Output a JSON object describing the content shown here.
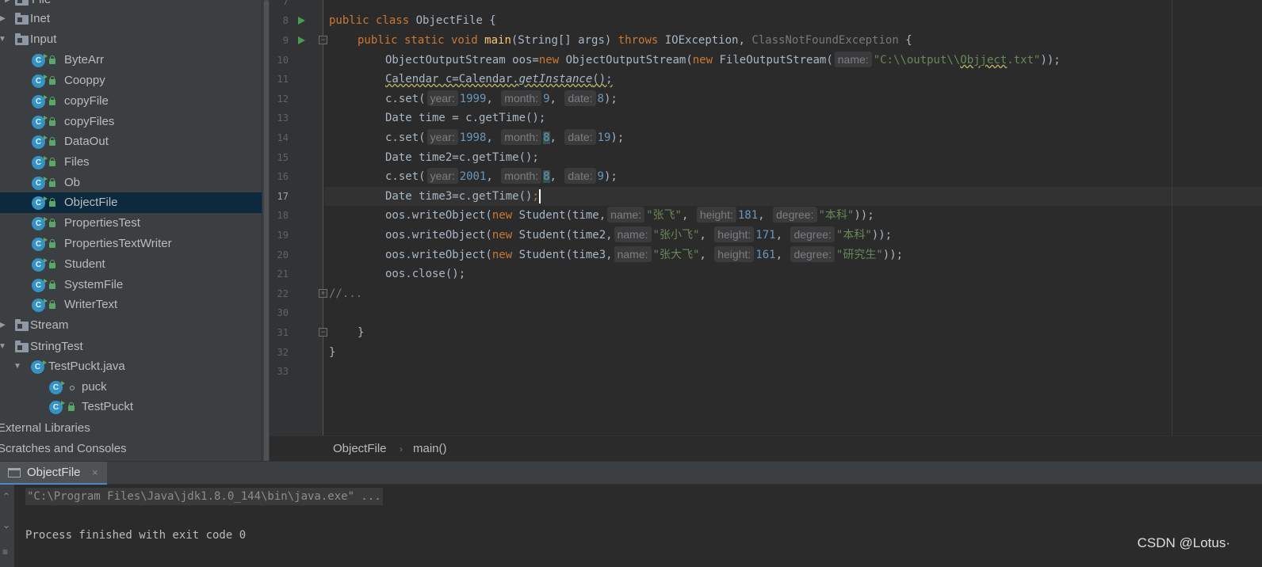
{
  "project_tree": {
    "items": [
      {
        "label": "File",
        "type": "package",
        "expanded": false
      },
      {
        "label": "Inet",
        "type": "package",
        "expanded": false
      },
      {
        "label": "Input",
        "type": "package",
        "expanded": true
      },
      {
        "label": "ByteArr",
        "type": "class"
      },
      {
        "label": "Cooppy",
        "type": "class"
      },
      {
        "label": "copyFile",
        "type": "class"
      },
      {
        "label": "copyFiles",
        "type": "class"
      },
      {
        "label": "DataOut",
        "type": "class"
      },
      {
        "label": "Files",
        "type": "class"
      },
      {
        "label": "Ob",
        "type": "class"
      },
      {
        "label": "ObjectFile",
        "type": "class",
        "selected": true
      },
      {
        "label": "PropertiesTest",
        "type": "class"
      },
      {
        "label": "PropertiesTextWriter",
        "type": "class"
      },
      {
        "label": "Student",
        "type": "class"
      },
      {
        "label": "SystemFile",
        "type": "class"
      },
      {
        "label": "WriterText",
        "type": "class"
      },
      {
        "label": "Stream",
        "type": "package",
        "expanded": false
      },
      {
        "label": "StringTest",
        "type": "package",
        "expanded": true
      },
      {
        "label": "TestPuckt.java",
        "type": "file",
        "expanded": true
      },
      {
        "label": "puck",
        "type": "inner-class"
      },
      {
        "label": "TestPuckt",
        "type": "inner-class"
      },
      {
        "label": "External Libraries",
        "type": "root"
      },
      {
        "label": "Scratches and Consoles",
        "type": "root"
      }
    ]
  },
  "editor": {
    "line_numbers": [
      "7",
      "8",
      "9",
      "10",
      "11",
      "12",
      "13",
      "14",
      "15",
      "16",
      "17",
      "18",
      "19",
      "20",
      "21",
      "22",
      "30",
      "31",
      "32",
      "33"
    ],
    "current_line": "17",
    "code": {
      "class_kw": "public class",
      "class_name": "ObjectFile {",
      "main_kw": "public static void",
      "main_name": "main",
      "main_params": "(String[] args) ",
      "throws_kw": "throws",
      "exc1": " IOException, ",
      "exc2": "ClassNotFoundException",
      "main_brace": " {",
      "l10a": "ObjectOutputStream oos=",
      "new_kw": "new",
      "l10b": " ObjectOutputStream(",
      "l10c": " FileOutputStream(",
      "hint_name": "name:",
      "l10_str_a": "\"C:\\\\output\\\\",
      "l10_str_b": "Objject",
      "l10_str_c": ".txt\"",
      "l10_end": "));",
      "l11a": "Calendar c=Calendar.",
      "l11b": "getInstance",
      "l11c": "();",
      "cset": "c.set(",
      "hint_year": "year:",
      "hint_month": "month:",
      "hint_date": "date:",
      "comma": ", ",
      "end_paren": ");",
      "l12_year": "1999",
      "l12_month": "9",
      "l12_date": "8",
      "l13": "Date time = c.getTime();",
      "l14_year": "1998",
      "l14_month": "8",
      "l14_date": "19",
      "l15": "Date time2=c.getTime();",
      "l16_year": "2001",
      "l16_month": "8",
      "l16_date": "9",
      "l17a": "Date time3=c.getTime()",
      "l17b": ";",
      "write_a": "oos.writeObject(",
      "student": " Student(",
      "hint_height": "height:",
      "hint_degree": "degree:",
      "end2": "));",
      "l18_arg": "time,",
      "l18_name": "\"张飞\"",
      "l18_height": "181",
      "l18_degree": "\"本科\"",
      "l19_arg": "time2,",
      "l19_name": "\"张小飞\"",
      "l19_height": "171",
      "l19_degree": "\"本科\"",
      "l20_arg": "time3,",
      "l20_name": "\"张大飞\"",
      "l20_height": "161",
      "l20_degree": "\"研究生\"",
      "l21": "oos.close();",
      "l22": "//...",
      "l31": "}",
      "l32": "}"
    }
  },
  "breadcrumb": {
    "items": [
      "ObjectFile",
      "main()"
    ],
    "separator": "›"
  },
  "run_window": {
    "tab_label": "ObjectFile",
    "close_glyph": "×",
    "console_lines": [
      "\"C:\\Program Files\\Java\\jdk1.8.0_144\\bin\\java.exe\" ...",
      "Process finished with exit code 0"
    ]
  },
  "watermark": "CSDN @Lotus·",
  "colors": {
    "keyword": "#cc7832",
    "function": "#ffc66d",
    "string": "#6a8759",
    "number": "#6897bb",
    "selection": "#0d293e",
    "accent": "#4a88c7"
  }
}
